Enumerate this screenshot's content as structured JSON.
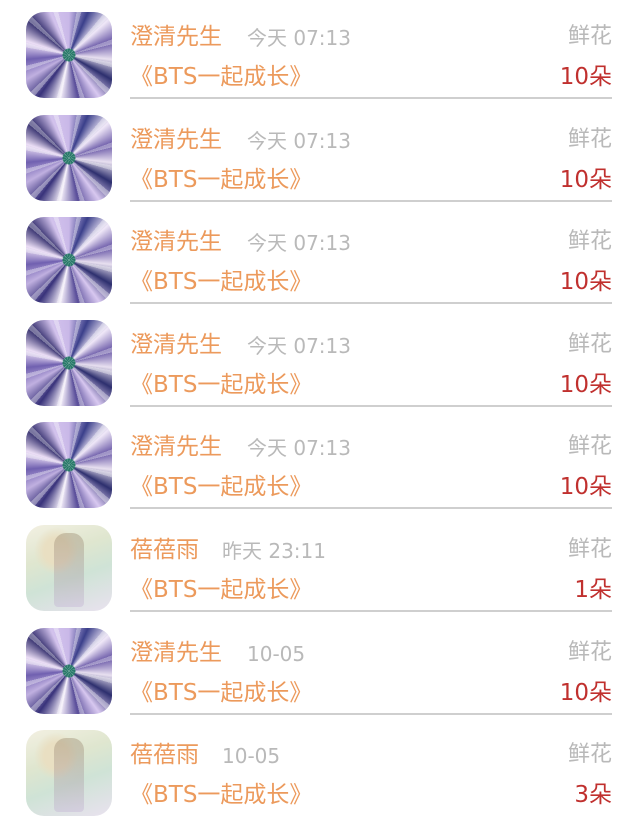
{
  "gift_list": {
    "rows": [
      {
        "user": "澄清先生",
        "time": "今天 07:13",
        "gift_type": "鲜花",
        "book": "《BTS一起成长》",
        "count": "10朵",
        "avatar": "avatar-1"
      },
      {
        "user": "澄清先生",
        "time": "今天 07:13",
        "gift_type": "鲜花",
        "book": "《BTS一起成长》",
        "count": "10朵",
        "avatar": "avatar-1"
      },
      {
        "user": "澄清先生",
        "time": "今天 07:13",
        "gift_type": "鲜花",
        "book": "《BTS一起成长》",
        "count": "10朵",
        "avatar": "avatar-1"
      },
      {
        "user": "澄清先生",
        "time": "今天 07:13",
        "gift_type": "鲜花",
        "book": "《BTS一起成长》",
        "count": "10朵",
        "avatar": "avatar-1"
      },
      {
        "user": "澄清先生",
        "time": "今天 07:13",
        "gift_type": "鲜花",
        "book": "《BTS一起成长》",
        "count": "10朵",
        "avatar": "avatar-1"
      },
      {
        "user": "蓓蓓雨",
        "time": "昨天 23:11",
        "gift_type": "鲜花",
        "book": "《BTS一起成长》",
        "count": "1朵",
        "avatar": "avatar-2"
      },
      {
        "user": "澄清先生",
        "time": "10-05",
        "gift_type": "鲜花",
        "book": "《BTS一起成长》",
        "count": "10朵",
        "avatar": "avatar-1"
      },
      {
        "user": "蓓蓓雨",
        "time": "10-05",
        "gift_type": "鲜花",
        "book": "《BTS一起成长》",
        "count": "3朵",
        "avatar": "avatar-2"
      }
    ]
  },
  "colors": {
    "name": "#ec9a5c",
    "meta": "#b9b9b9",
    "count": "#c0302e",
    "divider": "#cfcfcf"
  }
}
